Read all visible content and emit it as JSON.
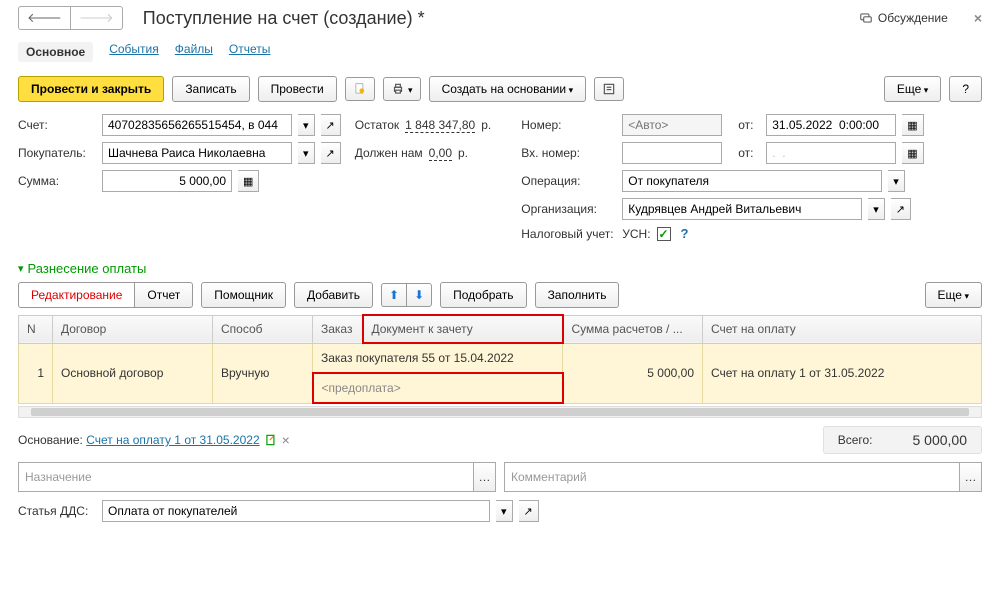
{
  "header": {
    "title": "Поступление на счет (создание) *",
    "discussion": "Обсуждение"
  },
  "tabs": [
    "Основное",
    "События",
    "Файлы",
    "Отчеты"
  ],
  "toolbar": {
    "post_close": "Провести и закрыть",
    "save": "Записать",
    "post": "Провести",
    "create_from": "Создать на основании",
    "more": "Еще",
    "help": "?"
  },
  "left": {
    "account_lbl": "Счет:",
    "account": "40702835656265515454, в 044",
    "balance_lbl": "Остаток",
    "balance": "1 848 347,80",
    "balance_cur": "р.",
    "buyer_lbl": "Покупатель:",
    "buyer": "Шачнева Раиса Николаевна",
    "owe_lbl": "Должен нам",
    "owe": "0,00",
    "owe_cur": "р.",
    "sum_lbl": "Сумма:",
    "sum": "5 000,00"
  },
  "right": {
    "num_lbl": "Номер:",
    "num_ph": "<Авто>",
    "from_lbl": "от:",
    "date": "31.05.2022  0:00:00",
    "innum_lbl": "Вх. номер:",
    "from2_lbl": "от:",
    "date2": ".  .",
    "op_lbl": "Операция:",
    "op": "От покупателя",
    "org_lbl": "Организация:",
    "org": "Кудрявцев Андрей Витальевич",
    "tax_lbl": "Налоговый учет:",
    "tax": "УСН:"
  },
  "section": {
    "title": "Разнесение оплаты",
    "edit": "Редактирование",
    "report": "Отчет",
    "helper": "Помощник",
    "add": "Добавить",
    "pick": "Подобрать",
    "fill": "Заполнить",
    "more": "Еще"
  },
  "grid": {
    "cols": [
      "N",
      "Договор",
      "Способ",
      "Заказ",
      "Документ к зачету",
      "Сумма расчетов / ...",
      "Счет на оплату"
    ],
    "row": {
      "n": "1",
      "contract": "Основной договор",
      "method": "Вручную",
      "doc": "Заказ покупателя 55 от 15.04.2022",
      "prepay": "<предоплата>",
      "sum": "5 000,00",
      "invoice": "Счет на оплату 1 от 31.05.2022"
    }
  },
  "footer": {
    "basis_lbl": "Основание:",
    "basis": "Счет на оплату 1 от 31.05.2022",
    "total_lbl": "Всего:",
    "total": "5 000,00",
    "purpose_ph": "Назначение",
    "comment_ph": "Комментарий",
    "dds_lbl": "Статья ДДС:",
    "dds": "Оплата от покупателей"
  }
}
